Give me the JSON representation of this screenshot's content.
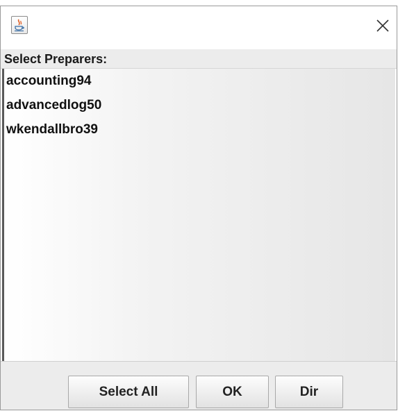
{
  "dialog": {
    "title": "",
    "close_icon": "close-icon",
    "app_icon": "java-icon",
    "header_label": "Select Preparers:"
  },
  "preparers": {
    "items": [
      "accounting94",
      "advancedlog50",
      "wkendallbro39"
    ]
  },
  "buttons": {
    "select_all_label": "Select All",
    "ok_label": "OK",
    "dir_label": "Dir"
  },
  "colors": {
    "header_bg": "#ececec",
    "button_bar_bg": "#ececec",
    "text": "#111111"
  }
}
